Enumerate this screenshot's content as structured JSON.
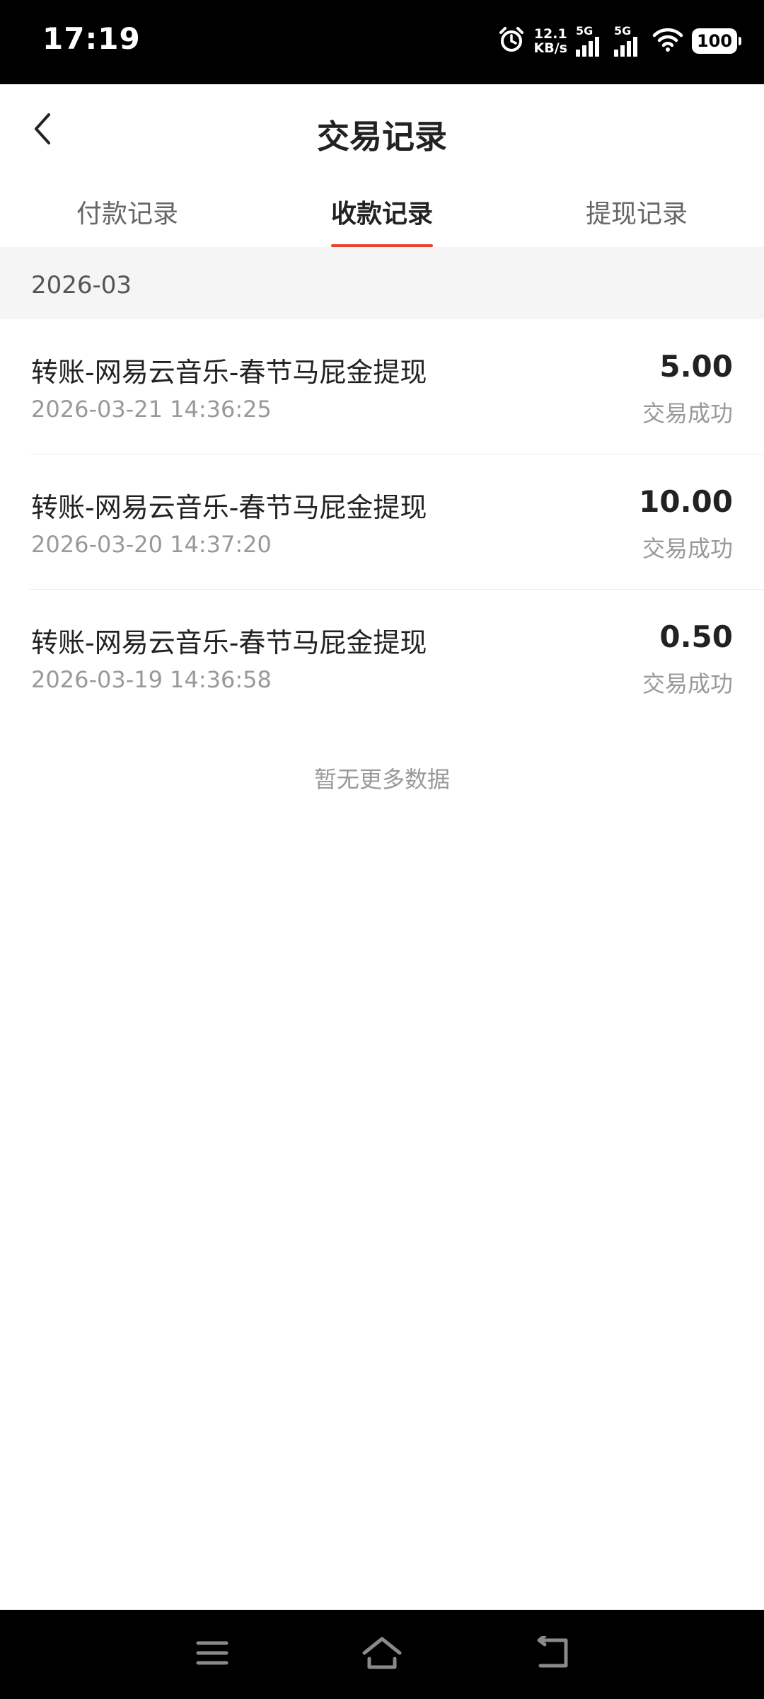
{
  "status_bar": {
    "time": "17:19",
    "net_speed_value": "12.1",
    "net_speed_unit": "KB/s",
    "signal_1_label": "5G",
    "signal_2_label": "5G",
    "battery": "100",
    "icons": [
      "alarm-icon",
      "signal-icon",
      "wifi-icon",
      "battery-icon"
    ]
  },
  "header": {
    "title": "交易记录",
    "back_icon": "chevron-left-icon"
  },
  "tabs": [
    {
      "label": "付款记录",
      "active": false
    },
    {
      "label": "收款记录",
      "active": true
    },
    {
      "label": "提现记录",
      "active": false
    }
  ],
  "accent_color": "#e8452b",
  "month_header": "2026-03",
  "transactions": [
    {
      "description": "转账-网易云音乐-春节马屁金提现",
      "time": "2026-03-21 14:36:25",
      "amount": "5.00",
      "status": "交易成功"
    },
    {
      "description": "转账-网易云音乐-春节马屁金提现",
      "time": "2026-03-20 14:37:20",
      "amount": "10.00",
      "status": "交易成功"
    },
    {
      "description": "转账-网易云音乐-春节马屁金提现",
      "time": "2026-03-19 14:36:58",
      "amount": "0.50",
      "status": "交易成功"
    }
  ],
  "no_more_text": "暂无更多数据",
  "nav_bar": {
    "icons": [
      "menu-icon",
      "home-icon",
      "back-icon"
    ]
  }
}
